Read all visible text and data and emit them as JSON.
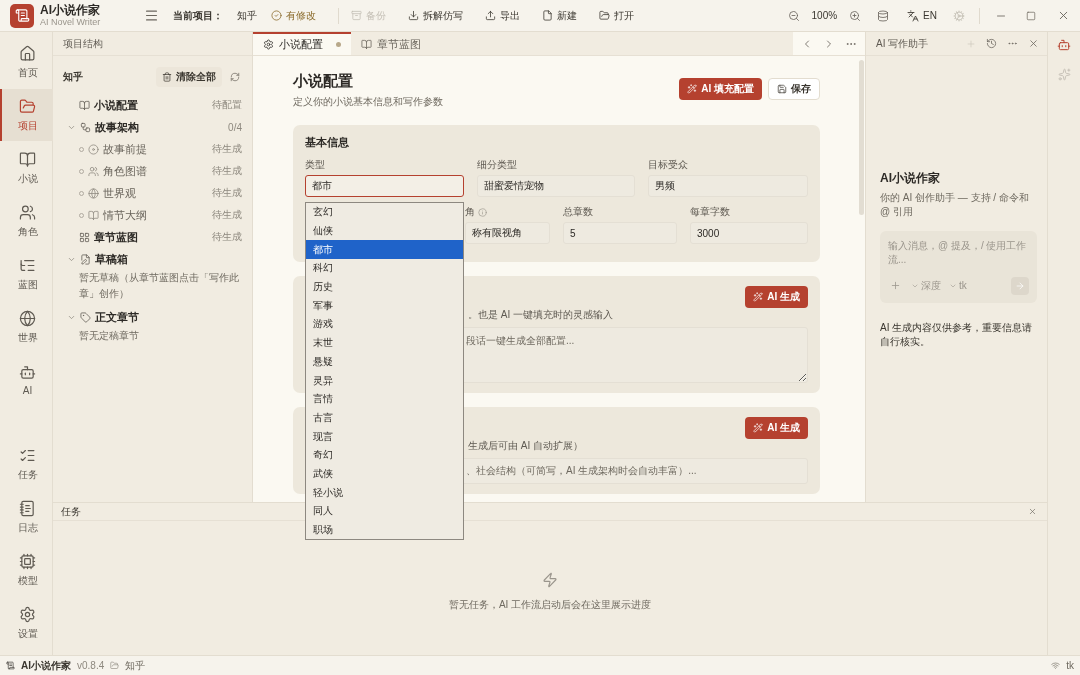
{
  "app": {
    "name": "AI小说作家",
    "subtitle": "AI Novel Writer"
  },
  "toolbar": {
    "project_label": "当前项目：",
    "project": "知乎",
    "items": [
      {
        "label": "有修改",
        "kind": "status",
        "disabled": false
      },
      {
        "label": "备份",
        "kind": "action",
        "disabled": true
      },
      {
        "label": "拆解仿写",
        "kind": "action",
        "disabled": false
      },
      {
        "label": "导出",
        "kind": "action",
        "disabled": false
      },
      {
        "label": "新建",
        "kind": "action",
        "disabled": false
      },
      {
        "label": "打开",
        "kind": "action",
        "disabled": false
      }
    ]
  },
  "view": {
    "zoom": "100%",
    "language": "EN"
  },
  "nav": {
    "top": [
      {
        "label": "首页",
        "selected": false
      },
      {
        "label": "项目",
        "selected": true
      },
      {
        "label": "小说",
        "selected": false
      },
      {
        "label": "角色",
        "selected": false
      },
      {
        "label": "蓝图",
        "selected": false
      },
      {
        "label": "世界",
        "selected": false
      },
      {
        "label": "AI",
        "selected": false
      }
    ],
    "bottom": [
      {
        "label": "任务",
        "selected": false
      },
      {
        "label": "日志",
        "selected": false
      },
      {
        "label": "模型",
        "selected": false
      },
      {
        "label": "设置",
        "selected": false
      }
    ]
  },
  "tree": {
    "title": "项目结构",
    "project": "知乎",
    "clear_button": "清除全部",
    "items": [
      {
        "label": "小说配置",
        "status": "待配置"
      },
      {
        "label": "故事架构",
        "status": "0/4",
        "expanded": true,
        "children": [
          {
            "label": "故事前提",
            "status": "待生成"
          },
          {
            "label": "角色图谱",
            "status": "待生成"
          },
          {
            "label": "世界观",
            "status": "待生成"
          },
          {
            "label": "情节大纲",
            "status": "待生成"
          }
        ]
      },
      {
        "label": "章节蓝图",
        "status": "待生成"
      },
      {
        "label": "草稿箱",
        "expanded": true,
        "note": "暂无草稿（从章节蓝图点击「写作此章」创作）"
      },
      {
        "label": "正文章节",
        "expanded": true,
        "note": "暂无定稿章节"
      }
    ]
  },
  "tabs": [
    {
      "label": "小说配置",
      "selected": true,
      "modified": true
    },
    {
      "label": "章节蓝图",
      "selected": false,
      "modified": false
    }
  ],
  "config": {
    "title": "小说配置",
    "subtitle": "定义你的小说基本信息和写作参数",
    "fill_button": "AI 填充配置",
    "save_button": "保存",
    "basic": {
      "title": "基本信息",
      "row_1": [
        {
          "label": "类型",
          "value": "都市",
          "focused": true
        },
        {
          "label": "细分类型",
          "value": "甜蜜爱情宠物",
          "focused": false
        },
        {
          "label": "目标受众",
          "value": "男频",
          "focused": false
        }
      ],
      "row_2": [
        {
          "label": "角",
          "value": "称有限视角",
          "info": true,
          "focused": false
        },
        {
          "label": "总章数",
          "value": "5",
          "focused": false
        },
        {
          "label": "每章字数",
          "value": "3000",
          "focused": false
        }
      ]
    },
    "sections": [
      {
        "button": "AI 生成",
        "description": "。也是 AI 一键填充时的灵感输入",
        "placeholder": "段话一键生成全部配置...",
        "kind": "textarea"
      },
      {
        "button": "AI 生成",
        "description": "生成后可由 AI 自动扩展）",
        "placeholder": "、社会结构（可简写，AI 生成架构时会自动丰富）...",
        "kind": "input"
      }
    ]
  },
  "dropdown": {
    "options": [
      {
        "label": "玄幻",
        "selected": false
      },
      {
        "label": "仙侠",
        "selected": false
      },
      {
        "label": "都市",
        "selected": true
      },
      {
        "label": "科幻",
        "selected": false
      },
      {
        "label": "历史",
        "selected": false
      },
      {
        "label": "军事",
        "selected": false
      },
      {
        "label": "游戏",
        "selected": false
      },
      {
        "label": "末世",
        "selected": false
      },
      {
        "label": "悬疑",
        "selected": false
      },
      {
        "label": "灵异",
        "selected": false
      },
      {
        "label": "言情",
        "selected": false
      },
      {
        "label": "古言",
        "selected": false
      },
      {
        "label": "现言",
        "selected": false
      },
      {
        "label": "奇幻",
        "selected": false
      },
      {
        "label": "武侠",
        "selected": false
      },
      {
        "label": "轻小说",
        "selected": false
      },
      {
        "label": "同人",
        "selected": false
      },
      {
        "label": "职场",
        "selected": false
      }
    ]
  },
  "ai_panel": {
    "header": "AI 写作助手",
    "title": "AI小说作家",
    "description": "你的 AI 创作助手 — 支持 / 命令和 @ 引用",
    "placeholder": "输入消息，@ 提及，/ 使用工作流...",
    "mode": "深度",
    "model": "tk",
    "note": "AI 生成内容仅供参考，重要信息请自行核实。"
  },
  "tasks": {
    "title": "任务",
    "empty": "暂无任务，AI 工作流启动后会在这里展示进度"
  },
  "status_bar": {
    "app": "AI小说作家",
    "version": "v0.8.4",
    "project": "知乎",
    "model": "tk"
  }
}
